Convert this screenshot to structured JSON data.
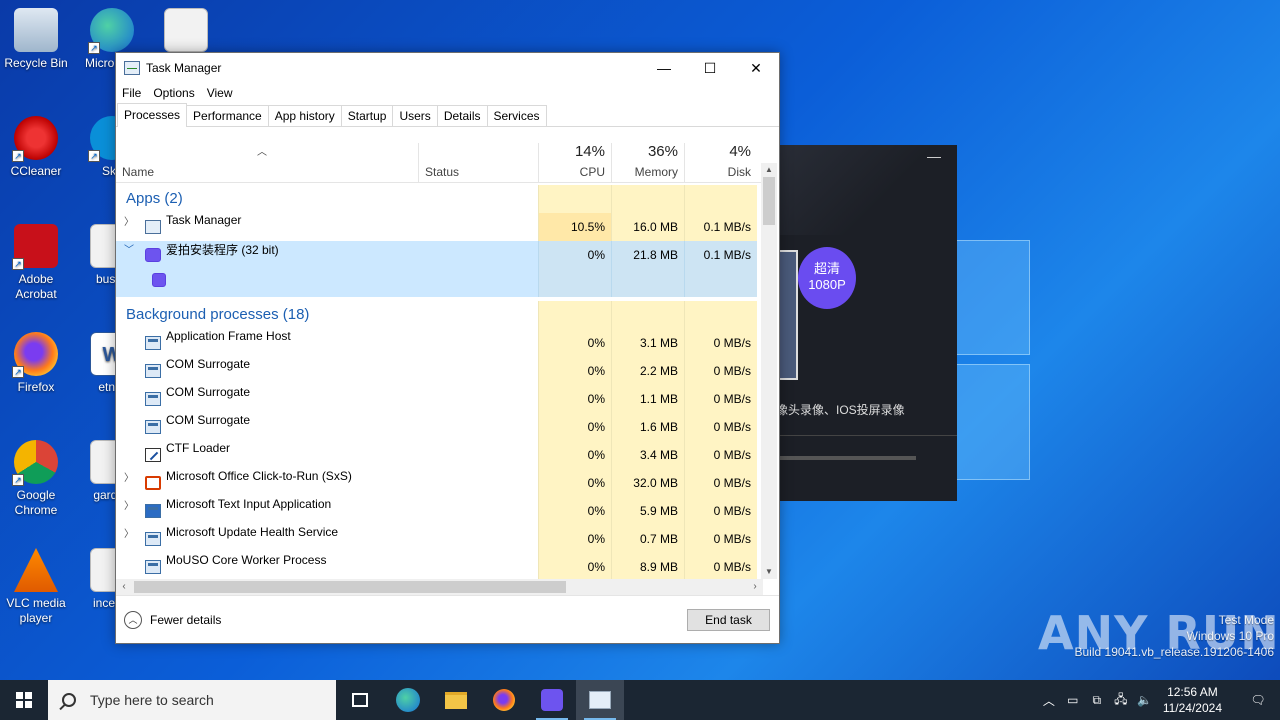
{
  "desktop": {
    "icons": [
      {
        "label": "Recycle Bin"
      },
      {
        "label": "Micro Edg"
      },
      {
        "label": "CCleaner"
      },
      {
        "label": "Sky"
      },
      {
        "label": "Adobe Acrobat"
      },
      {
        "label": "bushc"
      },
      {
        "label": "Firefox"
      },
      {
        "label": "etnor"
      },
      {
        "label": "Google Chrome"
      },
      {
        "label": "garden"
      },
      {
        "label": "VLC media player"
      },
      {
        "label": "incesth"
      }
    ]
  },
  "bg_app": {
    "badge": "超清\n1080P",
    "caption": "像头录像、IOS投屏录像"
  },
  "task_manager": {
    "title": "Task Manager",
    "menu": [
      "File",
      "Options",
      "View"
    ],
    "tabs": [
      "Processes",
      "Performance",
      "App history",
      "Startup",
      "Users",
      "Details",
      "Services"
    ],
    "active_tab": "Processes",
    "columns": {
      "name": "Name",
      "status": "Status",
      "cpu": {
        "pct": "14%",
        "label": "CPU"
      },
      "memory": {
        "pct": "36%",
        "label": "Memory"
      },
      "disk": {
        "pct": "4%",
        "label": "Disk"
      }
    },
    "groups": {
      "apps": "Apps (2)",
      "background": "Background processes (18)"
    },
    "apps": [
      {
        "name": "Task Manager",
        "cpu": "10.5%",
        "memory": "16.0 MB",
        "disk": "0.1 MB/s",
        "icon": "task-manager-icon"
      },
      {
        "name": "爱拍安装程序 (32 bit)",
        "cpu": "0%",
        "memory": "21.8 MB",
        "disk": "0.1 MB/s",
        "icon": "aipai-icon"
      }
    ],
    "background": [
      {
        "name": "Application Frame Host",
        "cpu": "0%",
        "memory": "3.1 MB",
        "disk": "0 MB/s"
      },
      {
        "name": "COM Surrogate",
        "cpu": "0%",
        "memory": "2.2 MB",
        "disk": "0 MB/s"
      },
      {
        "name": "COM Surrogate",
        "cpu": "0%",
        "memory": "1.1 MB",
        "disk": "0 MB/s"
      },
      {
        "name": "COM Surrogate",
        "cpu": "0%",
        "memory": "1.6 MB",
        "disk": "0 MB/s"
      },
      {
        "name": "CTF Loader",
        "cpu": "0%",
        "memory": "3.4 MB",
        "disk": "0 MB/s"
      },
      {
        "name": "Microsoft Office Click-to-Run (SxS)",
        "cpu": "0%",
        "memory": "32.0 MB",
        "disk": "0 MB/s"
      },
      {
        "name": "Microsoft Text Input Application",
        "cpu": "0%",
        "memory": "5.9 MB",
        "disk": "0 MB/s"
      },
      {
        "name": "Microsoft Update Health Service",
        "cpu": "0%",
        "memory": "0.7 MB",
        "disk": "0 MB/s"
      },
      {
        "name": "MoUSO Core Worker Process",
        "cpu": "0%",
        "memory": "8.9 MB",
        "disk": "0 MB/s"
      }
    ],
    "footer": {
      "fewer_details": "Fewer details",
      "end_task": "End task"
    }
  },
  "watermark": {
    "brand": "ANY RUN",
    "line1": "Test Mode",
    "line2": "Windows 10 Pro",
    "line3": "Build 19041.vb_release.191206-1406"
  },
  "taskbar": {
    "search_placeholder": "Type here to search",
    "time": "12:56 AM",
    "date": "11/24/2024"
  }
}
